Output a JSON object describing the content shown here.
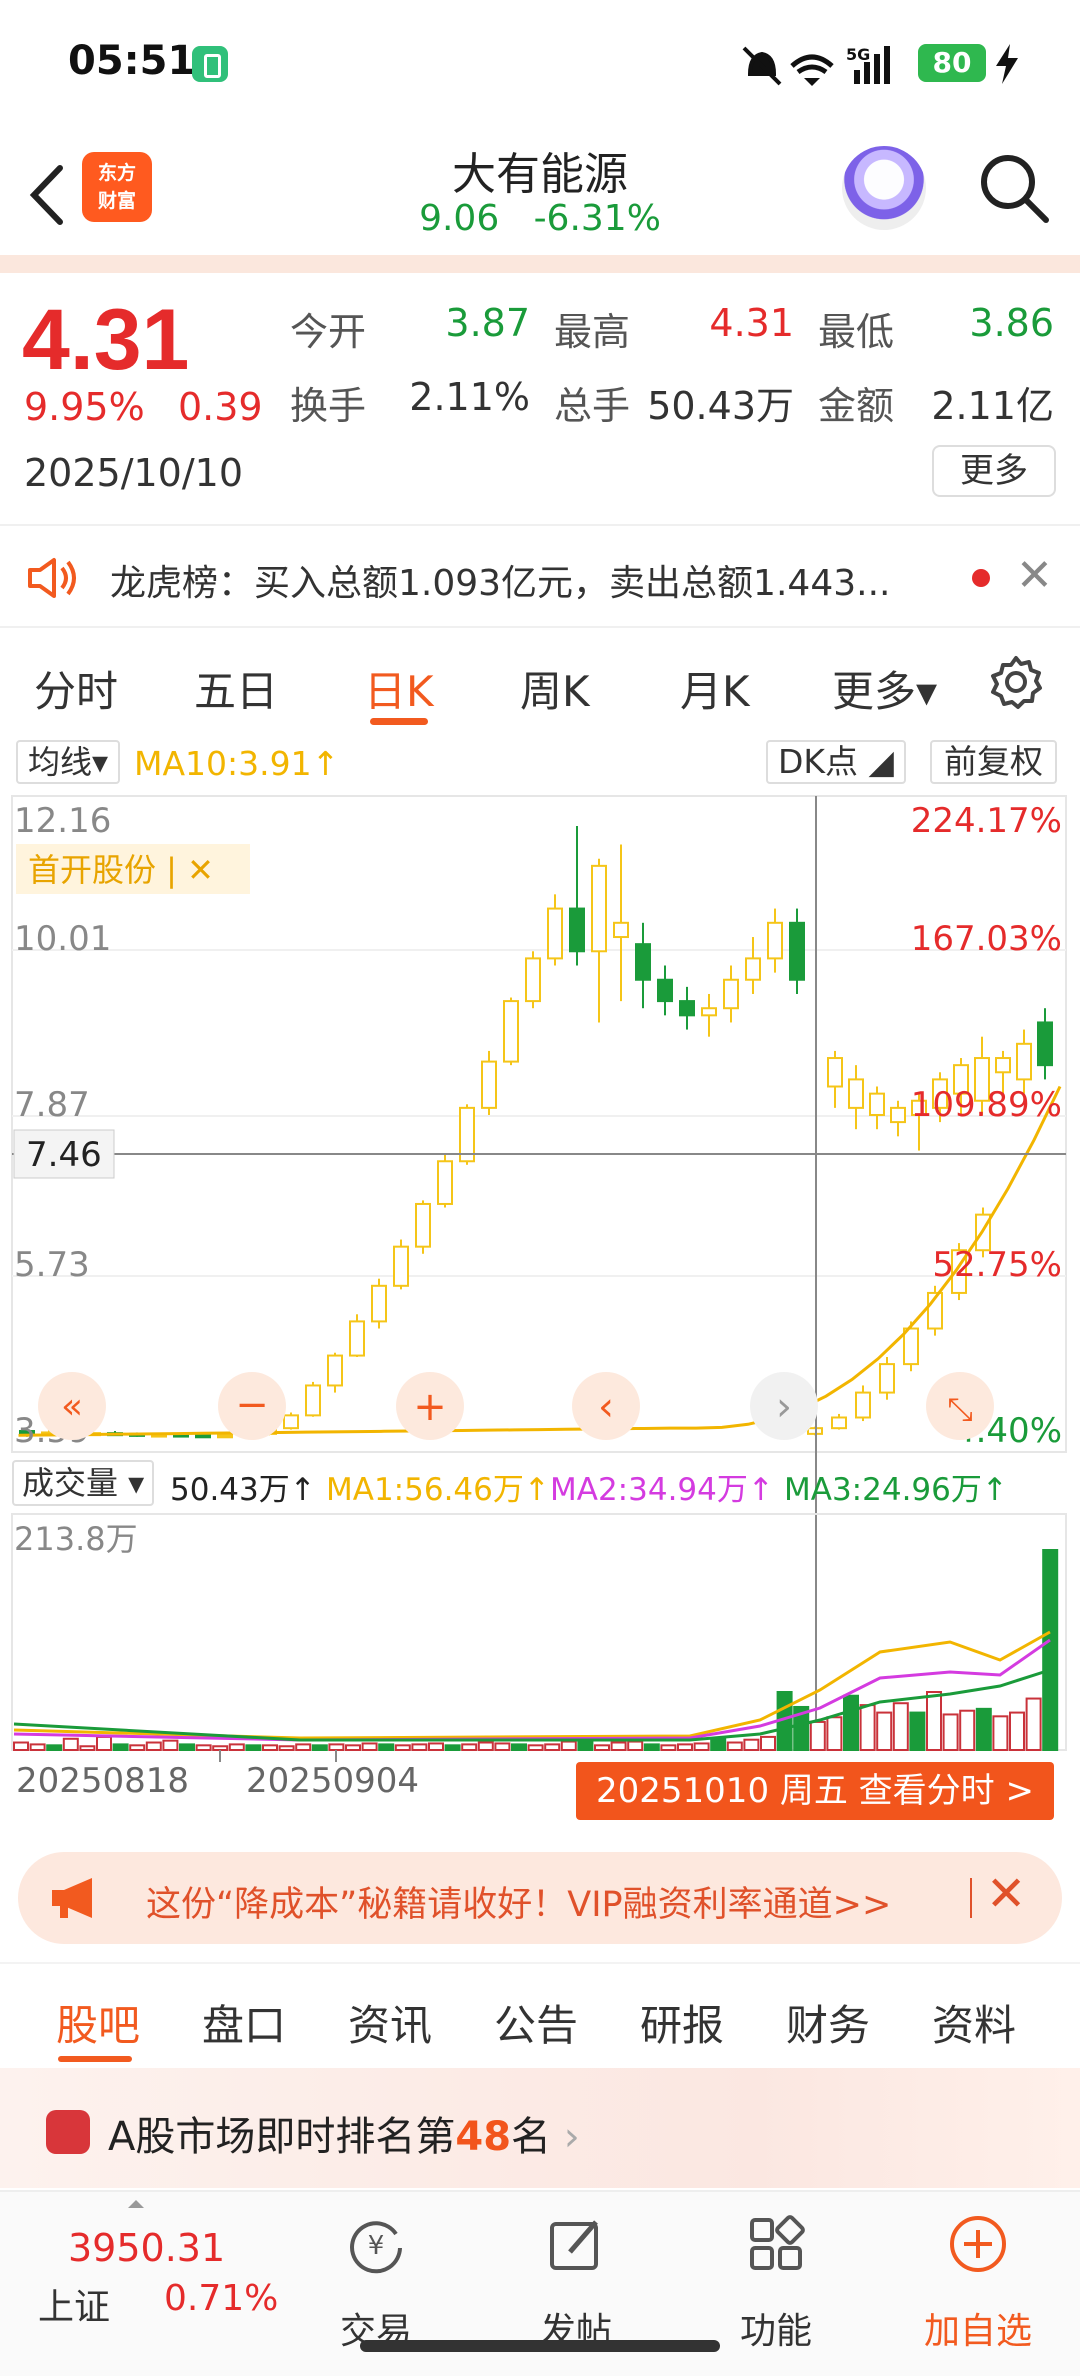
{
  "status": {
    "time": "05:51",
    "battery": "80",
    "network": "5G"
  },
  "header": {
    "stock_name": "大有能源",
    "sub_price": "9.06",
    "sub_pct": "-6.31%"
  },
  "quote": {
    "price": "4.31",
    "pct": "9.95%",
    "change": "0.39",
    "date": "2025/10/10",
    "open_label": "今开",
    "open": "3.87",
    "high_label": "最高",
    "high": "4.31",
    "low_label": "最低",
    "low": "3.86",
    "turnover_label": "换手",
    "turnover": "2.11%",
    "volume_label": "总手",
    "volume": "50.43万",
    "amount_label": "金额",
    "amount": "2.11亿",
    "more_label": "更多"
  },
  "notice": {
    "text": "龙虎榜：买入总额1.093亿元，卖出总额1.443...",
    "close": "✕"
  },
  "kline_tabs": [
    {
      "label": "分时"
    },
    {
      "label": "五日"
    },
    {
      "label": "日K"
    },
    {
      "label": "周K"
    },
    {
      "label": "月K"
    },
    {
      "label": "更多▾"
    }
  ],
  "indicators": {
    "ma_select": "均线▾",
    "ma10": "MA10:3.91↑",
    "dk": "DK点",
    "fq": "前复权",
    "crosshair_value": "7.46",
    "tag": "首开股份 | ✕",
    "y_left": [
      "12.16",
      "10.01",
      "7.87",
      "5.73",
      "3.59"
    ],
    "y_right": [
      "224.17%",
      "167.03%",
      "109.89%",
      "52.75%",
      "-4.40%"
    ]
  },
  "volume": {
    "select": "成交量 ▾",
    "current": "50.43万↑",
    "ma1": "MA1:56.46万↑",
    "ma2": "MA2:34.94万↑",
    "ma3": "MA3:24.96万↑",
    "max": "213.8万",
    "date_left": "20250818",
    "date_mid": "20250904",
    "banner": "20251010 周五 查看分时 >"
  },
  "promo": {
    "text": "这份“降成本”秘籍请收好！VIP融资利率通道>>",
    "close": "✕"
  },
  "section_tabs": [
    {
      "label": "股吧"
    },
    {
      "label": "盘口"
    },
    {
      "label": "资讯"
    },
    {
      "label": "公告"
    },
    {
      "label": "研报"
    },
    {
      "label": "财务"
    },
    {
      "label": "资料"
    }
  ],
  "rank": {
    "prefix": "A股市场即时排名第",
    "number": "48",
    "suffix": "名"
  },
  "bottom_nav": {
    "index_value": "3950.31",
    "index_name": "上证",
    "index_pct": "0.71%",
    "trade": "交易",
    "post": "发帖",
    "func": "功能",
    "watch": "加自选"
  },
  "colors": {
    "up": "#e52b2b",
    "down": "#1a9b3a",
    "accent": "#f25a1f",
    "ma": "#f2b500",
    "candle_yellow": "#f5c518"
  },
  "icons": [
    "back-icon",
    "logo-icon",
    "robot-avatar-icon",
    "search-icon",
    "speaker-icon",
    "close-icon",
    "gear-icon",
    "megaphone-icon",
    "chart-rank-icon",
    "trade-icon",
    "edit-icon",
    "grid-icon",
    "plus-circle-icon"
  ]
}
